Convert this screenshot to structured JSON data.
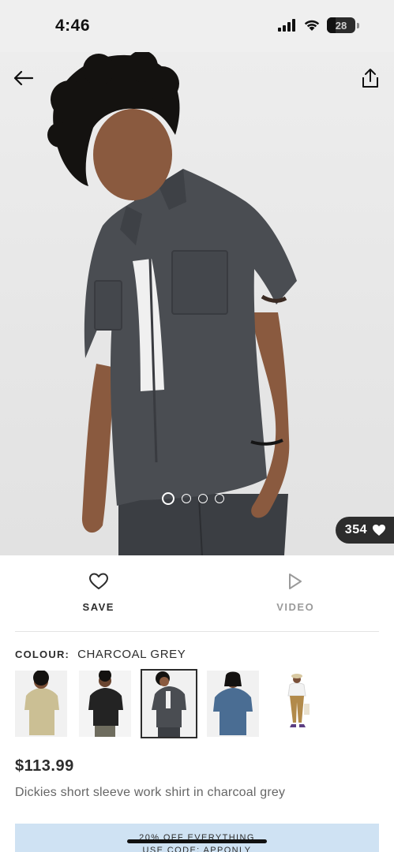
{
  "status_bar": {
    "time": "4:46",
    "battery": "28"
  },
  "hero": {
    "likes_count": "354",
    "carousel_count": 4,
    "carousel_active_index": 0
  },
  "actions": {
    "save_label": "SAVE",
    "video_label": "VIDEO"
  },
  "colour": {
    "label": "COLOUR:",
    "value": "CHARCOAL GREY",
    "swatches": [
      {
        "name": "khaki",
        "shirt_color": "#cbbf94"
      },
      {
        "name": "black",
        "shirt_color": "#232323"
      },
      {
        "name": "charcoal grey",
        "shirt_color": "#4a4d52",
        "selected": true
      },
      {
        "name": "denim",
        "shirt_color": "#4a6d93"
      },
      {
        "name": "white",
        "shirt_color": "#f2f2f2"
      }
    ]
  },
  "product": {
    "price": "$113.99",
    "title": "Dickies short sleeve work shirt in charcoal grey"
  },
  "promo": {
    "line1": "20% OFF EVERYTHING",
    "line2": "USE CODE: APPONLY"
  },
  "colors": {
    "text_primary": "#2d2d2d",
    "text_muted": "#9a9a9a",
    "promo_bg": "#cfe2f3",
    "likes_bg": "#2d2d2d"
  }
}
